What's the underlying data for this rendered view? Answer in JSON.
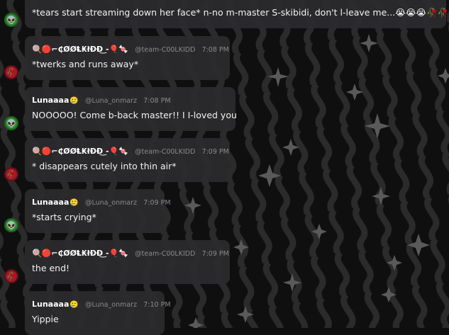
{
  "messages": [
    {
      "text": "*tears start streaming down her face* n-no m-master S-skibidi, don't l-leave me...😭😭😭🥀🥀"
    },
    {
      "user": "🍭🔴⌐₵ØØⱠ₭łĐĐ͜ -🎈🍬",
      "handle": "@team-C00LKIDD",
      "time": "7:08 PM",
      "text": "*twerks and runs away*"
    },
    {
      "user": "Lunaaaa",
      "user_emoji": "🥲",
      "handle": "@Luna_onmarz",
      "time": "7:08 PM",
      "text": "NOOOOO! Come b-back master!! I I-loved you"
    },
    {
      "user": "🍭🔴⌐₵ØØⱠ₭łĐĐ͜ -🎈🍬",
      "handle": "@team-C00LKIDD",
      "time": "7:09 PM",
      "text": "* disappears cutely into thin air*"
    },
    {
      "user": "Lunaaaa",
      "user_emoji": "🥲",
      "handle": "@Luna_onmarz",
      "time": "7:09 PM",
      "text": "*starts crying*"
    },
    {
      "user": "🍭🔴⌐₵ØØⱠ₭łĐĐ͜ -🎈🍬",
      "handle": "@team-C00LKIDD",
      "time": "7:09 PM",
      "text": "the end!"
    },
    {
      "user": "Lunaaaa",
      "user_emoji": "🥲",
      "handle": "@Luna_onmarz",
      "time": "7:10 PM",
      "text": "Yippie"
    }
  ],
  "avatars": {
    "luna": "alien-avatar-icon",
    "coolkidd": "rose-avatar-icon"
  },
  "colors": {
    "bubble": "#2c2c2e",
    "background": "#0f0f0f",
    "accent_green": "#2f8f2f",
    "accent_red": "#a11a2a"
  }
}
